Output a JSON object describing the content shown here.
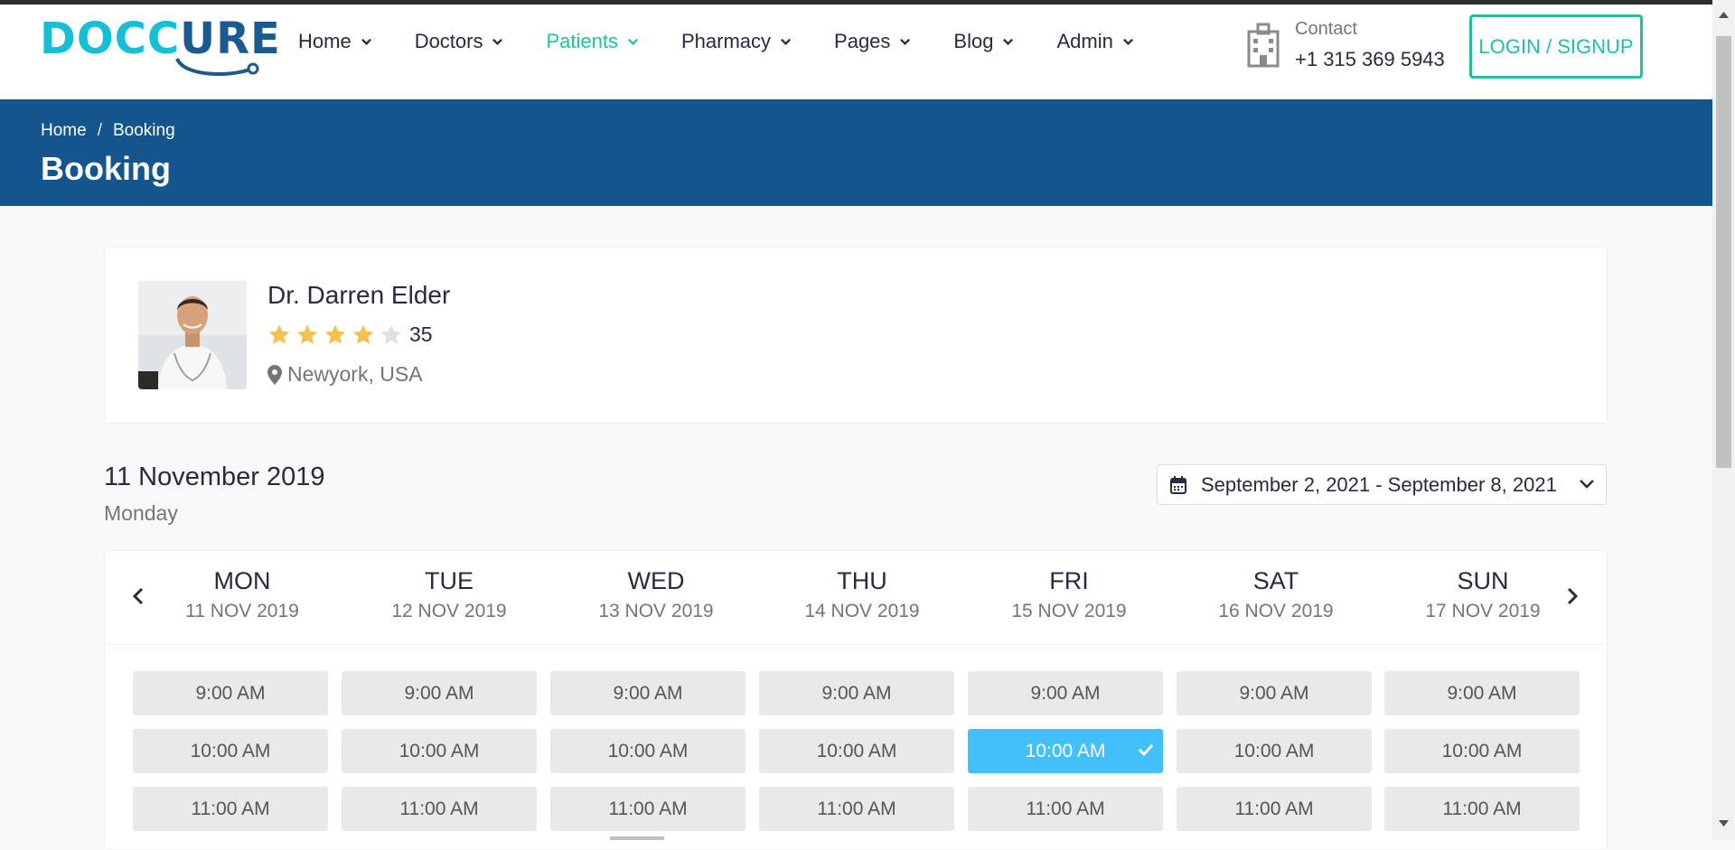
{
  "brand": {
    "logo_text_a": "DOCC",
    "logo_text_b": "URE"
  },
  "nav": [
    {
      "label": "Home",
      "active": false
    },
    {
      "label": "Doctors",
      "active": false
    },
    {
      "label": "Patients",
      "active": true
    },
    {
      "label": "Pharmacy",
      "active": false
    },
    {
      "label": "Pages",
      "active": false
    },
    {
      "label": "Blog",
      "active": false
    },
    {
      "label": "Admin",
      "active": false
    }
  ],
  "contact": {
    "label": "Contact",
    "phone": "+1 315 369 5943",
    "icon": "hospital-icon"
  },
  "login": {
    "label": "LOGIN / SIGNUP"
  },
  "breadcrumb": {
    "home": "Home",
    "separator": "/",
    "current": "Booking"
  },
  "page_title": "Booking",
  "doctor": {
    "name": "Dr. Darren Elder",
    "rating": 4,
    "max_rating": 5,
    "reviews": "35",
    "location": "Newyork, USA"
  },
  "selected": {
    "date": "11 November 2019",
    "day": "Monday"
  },
  "range": {
    "label": "September 2, 2021 - September 8, 2021"
  },
  "week": [
    {
      "day": "MON",
      "date": "11 NOV 2019"
    },
    {
      "day": "TUE",
      "date": "12 NOV 2019"
    },
    {
      "day": "WED",
      "date": "13 NOV 2019"
    },
    {
      "day": "THU",
      "date": "14 NOV 2019"
    },
    {
      "day": "FRI",
      "date": "15 NOV 2019"
    },
    {
      "day": "SAT",
      "date": "16 NOV 2019"
    },
    {
      "day": "SUN",
      "date": "17 NOV 2019"
    }
  ],
  "slots": [
    "9:00 AM",
    "10:00 AM",
    "11:00 AM"
  ],
  "selected_slot": {
    "day": "FRI",
    "time": "10:00 AM"
  },
  "colors": {
    "primary": "#15558d",
    "accent": "#20c0a2",
    "selected": "#42c0fb",
    "star": "#f4c150"
  }
}
